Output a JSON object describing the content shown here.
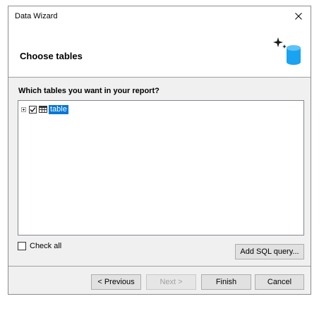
{
  "window": {
    "title": "Data Wizard",
    "close_glyph": "✕"
  },
  "header": {
    "title": "Choose tables",
    "icon": "database-sparkle-icon"
  },
  "question": "Which tables you want in your report?",
  "tree": {
    "items": [
      {
        "label": "table",
        "checked": true,
        "expanded": false,
        "selected": true
      }
    ]
  },
  "check_all": {
    "label": "Check all",
    "checked": false
  },
  "buttons": {
    "add_sql": "Add SQL query...",
    "previous": "< Previous",
    "next": "Next >",
    "finish": "Finish",
    "cancel": "Cancel"
  },
  "colors": {
    "selection": "#0078d7",
    "dialog_bg": "#f0f0f0",
    "database_icon": "#1aa3f0"
  }
}
